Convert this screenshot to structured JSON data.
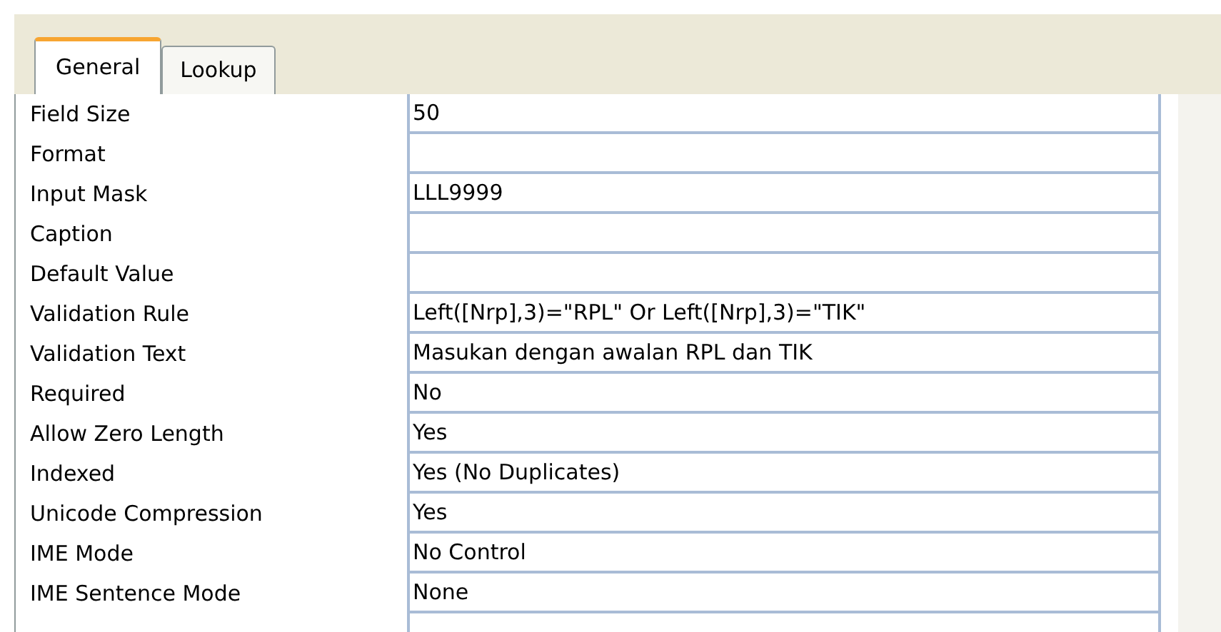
{
  "tabs": [
    {
      "label": "General",
      "selected": true
    },
    {
      "label": "Lookup",
      "selected": false
    }
  ],
  "properties": [
    {
      "name": "Field Size",
      "value": "50"
    },
    {
      "name": "Format"
    },
    {
      "name": "Input Mask",
      "value": "LLL9999"
    },
    {
      "name": "Caption"
    },
    {
      "name": "Default Value"
    },
    {
      "name": "Validation Rule",
      "value": "Left([Nrp],3)=\"RPL\" Or Left([Nrp],3)=\"TIK\""
    },
    {
      "name": "Validation Text",
      "value": "Masukan dengan awalan RPL dan TIK"
    },
    {
      "name": "Required",
      "value": "No"
    },
    {
      "name": "Allow Zero Length",
      "value": "Yes"
    },
    {
      "name": "Indexed",
      "value": "Yes (No Duplicates)"
    },
    {
      "name": "Unicode Compression",
      "value": "Yes"
    },
    {
      "name": "IME Mode",
      "value": "No Control"
    },
    {
      "name": "IME Sentence Mode",
      "value": "None"
    }
  ]
}
